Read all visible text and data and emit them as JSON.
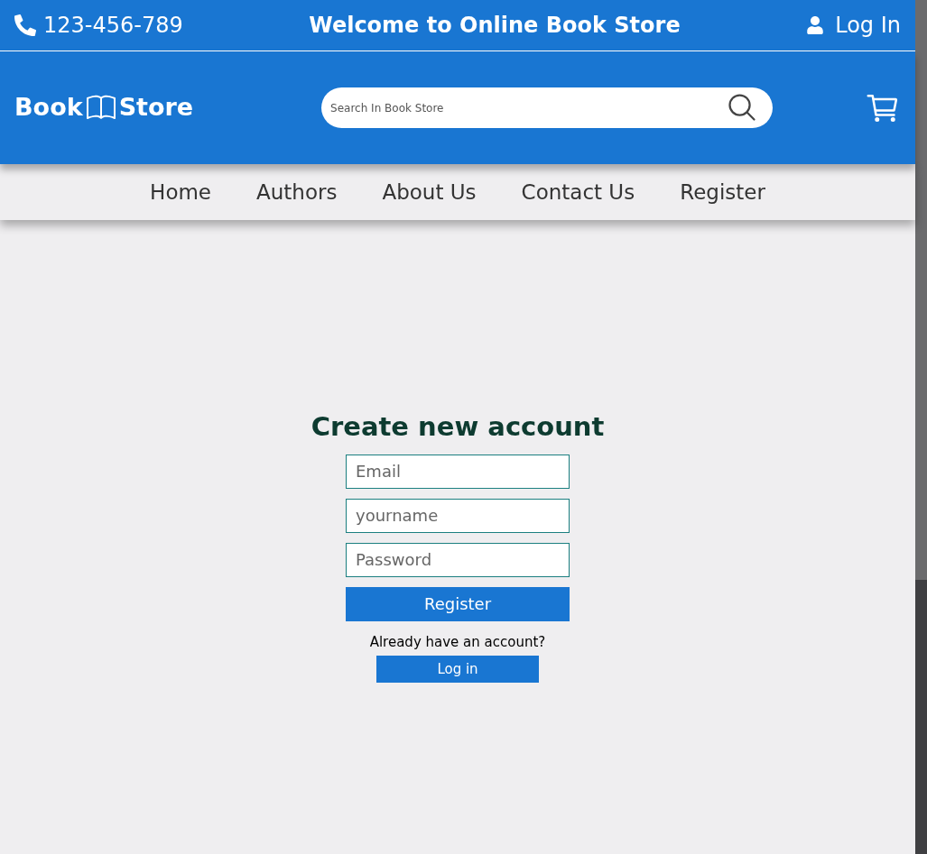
{
  "top_bar": {
    "phone": "123-456-789",
    "welcome": "Welcome to Online Book Store",
    "login": "Log In"
  },
  "header": {
    "logo_left": "Book",
    "logo_right": "Store",
    "search": {
      "placeholder": "Search In Book Store"
    }
  },
  "nav": [
    "Home",
    "Authors",
    "About Us",
    "Contact Us",
    "Register"
  ],
  "form": {
    "title": "Create new account",
    "fields": [
      {
        "placeholder": "Email"
      },
      {
        "placeholder": "yourname"
      },
      {
        "placeholder": "Password"
      }
    ],
    "submit": "Register",
    "prompt": "Already have an account?",
    "login_button": "Log in"
  }
}
